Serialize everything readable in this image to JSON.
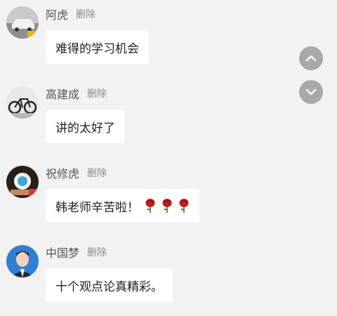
{
  "messages": [
    {
      "name": "阿虎",
      "delete_label": "删除",
      "text": "难得的学习机会"
    },
    {
      "name": "高建成",
      "delete_label": "删除",
      "text": "讲的太好了"
    },
    {
      "name": "祝修虎",
      "delete_label": "删除",
      "text": "韩老师辛苦啦！",
      "emoji": [
        "rose-icon",
        "rose-icon",
        "rose-icon"
      ]
    },
    {
      "name": "中国梦",
      "delete_label": "删除",
      "text": "十个观点论真精彩。"
    }
  ],
  "controls": {
    "scroll_up_icon": "chevron-up-icon",
    "scroll_down_icon": "chevron-down-icon"
  },
  "colors": {
    "background": "#f2f2f2",
    "bubble": "#ffffff",
    "button": "#a8a8a8",
    "rose": "#c41a1a"
  }
}
